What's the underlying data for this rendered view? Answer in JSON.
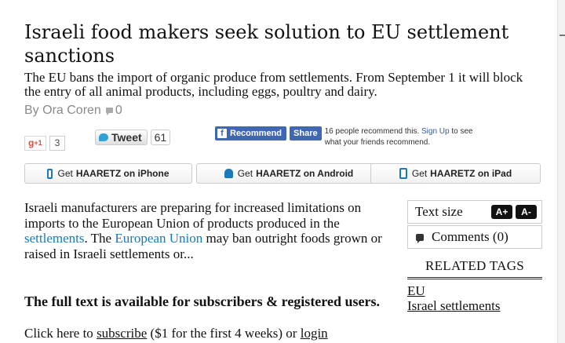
{
  "article": {
    "headline": "Israeli food makers seek solution to EU settlement sanctions",
    "subhead": "The EU bans the import of organic produce from settlements. From September 1 it will block the entry of all animal products, including eggs, poultry and dairy.",
    "byline": "By Ora Coren",
    "comment_count": "0"
  },
  "social": {
    "gplus_label": "+1",
    "gplus_count": "3",
    "tweet_label": "Tweet",
    "tweet_count": "61",
    "fb_recommend": "Recommend",
    "fb_share": "Share",
    "fb_text_pre": "16 people recommend this. ",
    "fb_signup": "Sign Up",
    "fb_text_post": " to see what your friends recommend."
  },
  "apps": {
    "iphone_pre": "Get",
    "iphone_brand": "HAARETZ on iPhone",
    "android_pre": "Get",
    "android_brand": "HAARETZ on Android",
    "ipad_pre": "Get",
    "ipad_brand": "HAARETZ on iPad"
  },
  "body": {
    "p1_a": "Israeli manufacturers are preparing for increased limitations on imports to the European Union of products produced in the ",
    "link_settlements": "settlements",
    "p1_b": ". The ",
    "link_eu": "European Union",
    "p1_c": " may ban outright foods grown or raised in Israeli settlements or...",
    "full_text": "The full text is available for subscribers & registered users.",
    "click_pre": "Click here to ",
    "subscribe": "subscribe",
    "click_mid": " ($1 for the first 4 weeks) or ",
    "login": "login"
  },
  "sidebar": {
    "text_size": "Text size",
    "increase": "A+",
    "decrease": "A-",
    "comments": "Comments (0)",
    "related_title": "RELATED TAGS",
    "tags": [
      "EU",
      "Israel settlements"
    ]
  },
  "colors": {
    "link": "#1a7ab8",
    "facebook": "#4267b2",
    "byline": "#8a8a8a"
  }
}
